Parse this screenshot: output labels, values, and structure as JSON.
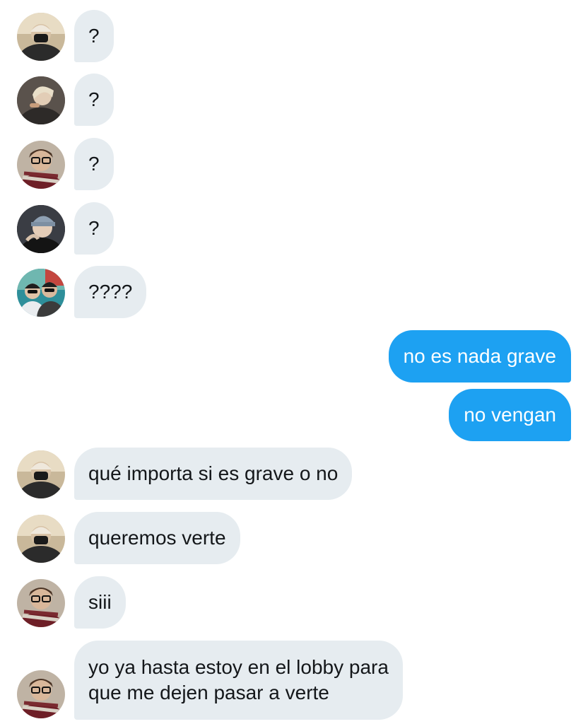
{
  "messages": [
    {
      "side": "in",
      "avatar": "avatar-masked-beanie",
      "text": "?"
    },
    {
      "side": "in",
      "avatar": "avatar-blond-hair",
      "text": "?"
    },
    {
      "side": "in",
      "avatar": "avatar-glasses-scarf",
      "text": "?"
    },
    {
      "side": "in",
      "avatar": "avatar-knit-beanie",
      "text": "?"
    },
    {
      "side": "in",
      "avatar": "avatar-two-friends",
      "text": "????"
    },
    {
      "side": "out",
      "text": "no es nada grave"
    },
    {
      "side": "out",
      "text": "no vengan"
    },
    {
      "side": "in",
      "avatar": "avatar-masked-beanie",
      "text": "qué importa si es grave o no"
    },
    {
      "side": "in",
      "avatar": "avatar-masked-beanie",
      "text": "queremos verte"
    },
    {
      "side": "in",
      "avatar": "avatar-glasses-scarf",
      "text": "siii"
    },
    {
      "side": "in",
      "avatar": "avatar-glasses-scarf",
      "text_line1": "yo ya hasta estoy en el lobby para",
      "text_line2": "que me dejen pasar a verte"
    }
  ],
  "colors": {
    "incoming_bubble": "#e6ecf0",
    "outgoing_bubble": "#1da1f2",
    "incoming_text": "#14171a",
    "outgoing_text": "#ffffff"
  }
}
